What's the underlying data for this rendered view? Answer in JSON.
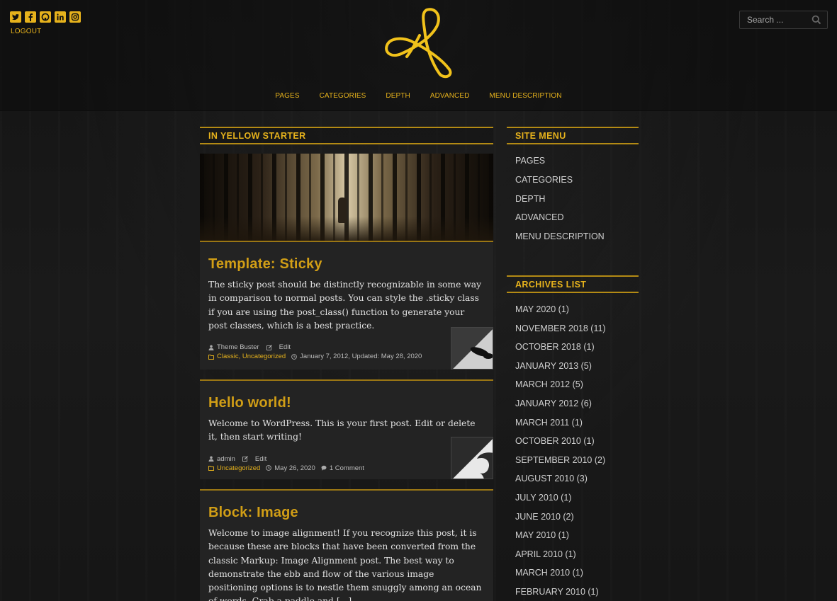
{
  "header": {
    "social_icons": [
      "twitter-icon",
      "facebook-icon",
      "github-icon",
      "linkedin-icon",
      "instagram-icon"
    ],
    "logout_label": "LOGOUT",
    "search_placeholder": "Search ...",
    "accent_color": "#e6b21c"
  },
  "nav": {
    "items": [
      "PAGES",
      "CATEGORIES",
      "DEPTH",
      "ADVANCED",
      "MENU DESCRIPTION"
    ]
  },
  "main": {
    "section_title": "IN YELLOW STARTER",
    "posts": [
      {
        "title": "Template: Sticky",
        "excerpt": "The sticky post should be distinctly recognizable in some way in comparison to normal posts. You can style the .sticky class if you are using the post_class() function to generate your post classes, which is a best practice.",
        "author": "Theme Buster",
        "edit": "Edit",
        "categories": "Classic, Uncategorized",
        "date": "January 7, 2012, Updated: May 28, 2020"
      },
      {
        "title": "Hello world!",
        "excerpt": "Welcome to WordPress. This is your first post. Edit or delete it, then start writing!",
        "author": "admin",
        "edit": "Edit",
        "categories": "Uncategorized",
        "date": "May 26, 2020",
        "comments": "1 Comment"
      },
      {
        "title": "Block: Image",
        "excerpt": "Welcome to image alignment! If you recognize this post, it is because these are blocks that have been converted from the classic Markup: Image Alignment post. The best way to demonstrate the ebb and flow of the various image positioning options is to nestle them snuggly among an ocean of words. Grab a paddle and [...]"
      }
    ]
  },
  "sidebar": {
    "menu_title": "SITE MENU",
    "menu_items": [
      "PAGES",
      "CATEGORIES",
      "DEPTH",
      "ADVANCED",
      "MENU DESCRIPTION"
    ],
    "archives_title": "ARCHIVES LIST",
    "archives": [
      "MAY 2020 (1)",
      "NOVEMBER 2018 (11)",
      "OCTOBER 2018 (1)",
      "JANUARY 2013 (5)",
      "MARCH 2012 (5)",
      "JANUARY 2012 (6)",
      "MARCH 2011 (1)",
      "OCTOBER 2010 (1)",
      "SEPTEMBER 2010 (2)",
      "AUGUST 2010 (3)",
      "JULY 2010 (1)",
      "JUNE 2010 (2)",
      "MAY 2010 (1)",
      "APRIL 2010 (1)",
      "MARCH 2010 (1)",
      "FEBRUARY 2010 (1)"
    ]
  }
}
